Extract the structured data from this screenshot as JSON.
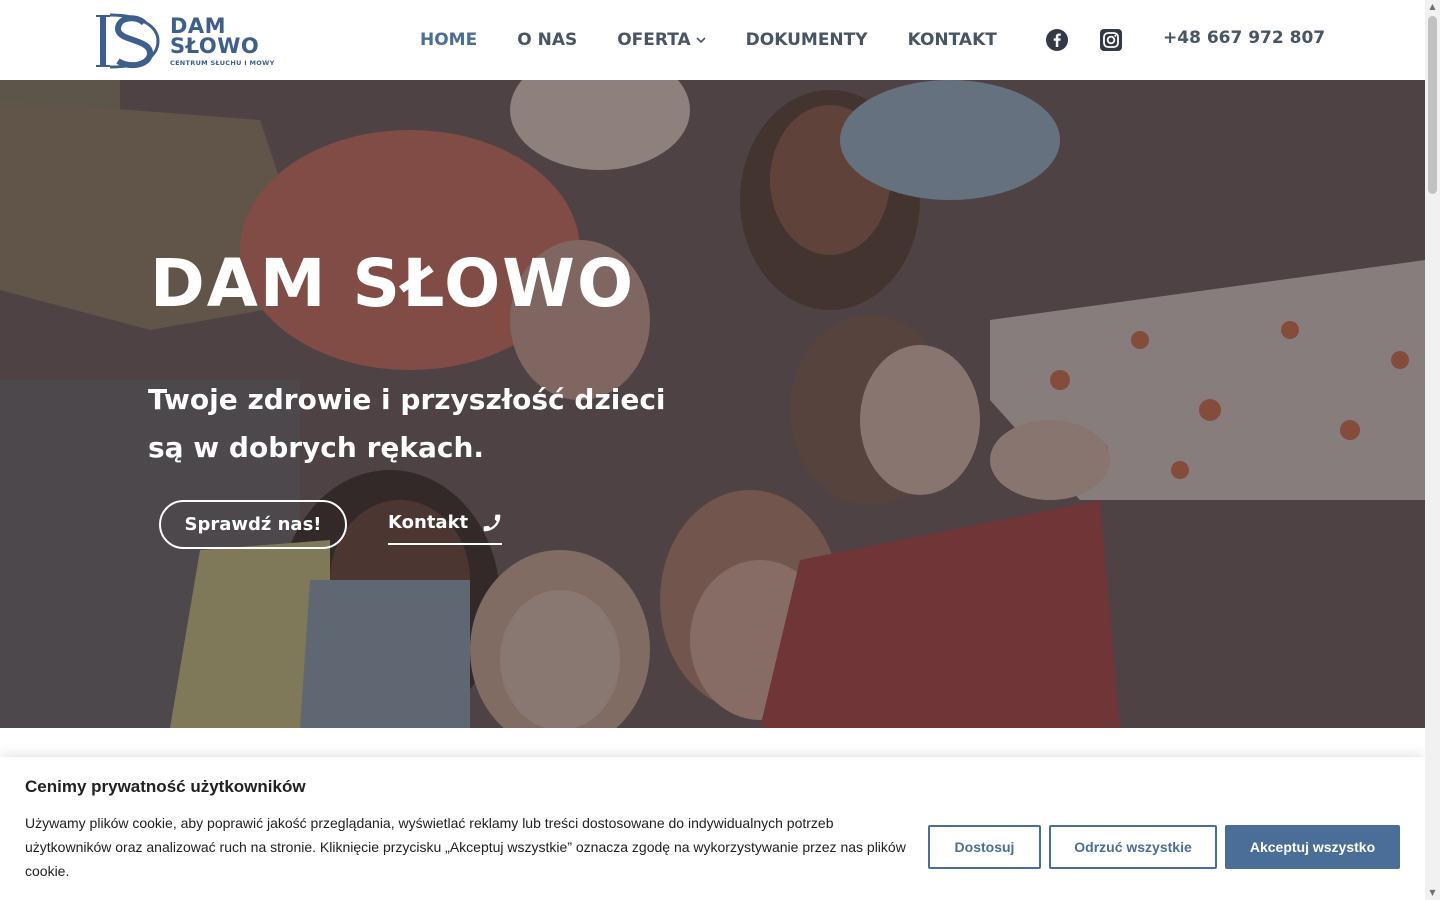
{
  "brand": {
    "name_line1": "DAM",
    "name_line2": "SŁOWO",
    "tagline": "CENTRUM SŁUCHU I MOWY",
    "color": "#3e5f8e"
  },
  "nav": {
    "items": [
      {
        "label": "HOME",
        "active": true
      },
      {
        "label": "O NAS",
        "active": false
      },
      {
        "label": "OFERTA",
        "active": false,
        "has_dropdown": true
      },
      {
        "label": "DOKUMENTY",
        "active": false
      },
      {
        "label": "KONTAKT",
        "active": false
      }
    ],
    "social": [
      {
        "icon": "facebook-icon"
      },
      {
        "icon": "instagram-icon"
      }
    ],
    "phone": "+48 667 972 807"
  },
  "hero": {
    "title": "DAM SŁOWO",
    "subtitle": "Twoje zdrowie i przyszłość dzieci są w dobrych rękach.",
    "primary_button": "Sprawdź nas!",
    "secondary_button": "Kontakt",
    "secondary_icon": "phone-icon"
  },
  "cookie": {
    "title": "Cenimy prywatność użytkowników",
    "text": "Używamy plików cookie, aby poprawić jakość przeglądania, wyświetlać reklamy lub treści dostosowane do indywidualnych potrzeb użytkowników oraz analizować ruch na stronie. Kliknięcie przycisku „Akceptuj wszystkie” oznacza zgodę na wykorzystywanie przez nas plików cookie.",
    "customize": "Dostosuj",
    "reject": "Odrzuć wszystkie",
    "accept": "Akceptuj wszystko"
  },
  "colors": {
    "accent": "#4b6e99",
    "nav_text": "#4a5563"
  }
}
